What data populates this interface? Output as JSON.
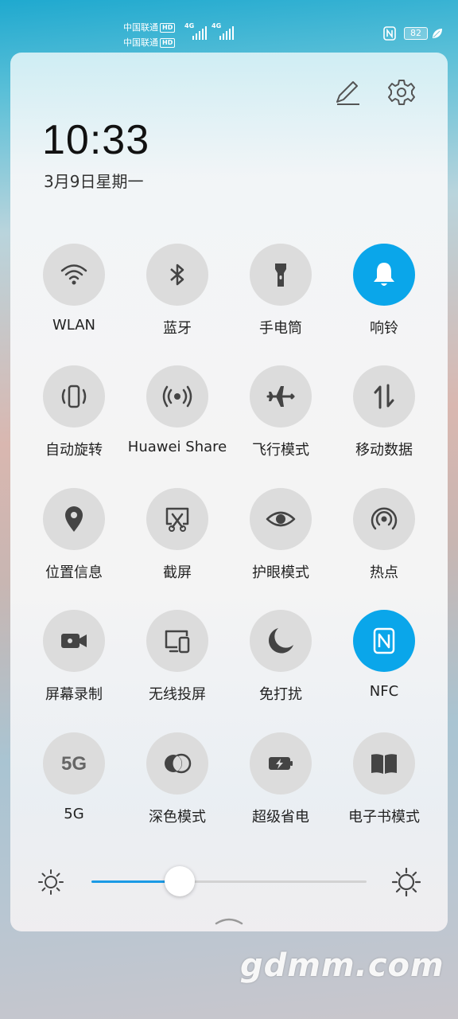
{
  "status_bar": {
    "carriers": [
      {
        "name": "中国联通",
        "badge": "HD"
      },
      {
        "name": "中国联通",
        "badge": "HD"
      }
    ],
    "network_tags": [
      "4G",
      "4G"
    ],
    "battery_level": "82",
    "icons": [
      "nfc-icon",
      "battery-icon",
      "leaf-icon"
    ]
  },
  "header": {
    "time": "10:33",
    "date": "3月9日星期一",
    "icons": [
      "edit-icon",
      "settings-icon"
    ]
  },
  "tiles": [
    {
      "label": "WLAN",
      "icon": "wifi-icon",
      "active": false
    },
    {
      "label": "蓝牙",
      "icon": "bluetooth-icon",
      "active": false
    },
    {
      "label": "手电筒",
      "icon": "flashlight-icon",
      "active": false
    },
    {
      "label": "响铃",
      "icon": "bell-icon",
      "active": true
    },
    {
      "label": "自动旋转",
      "icon": "auto-rotate-icon",
      "active": false
    },
    {
      "label": "Huawei Share",
      "icon": "huawei-share-icon",
      "active": false
    },
    {
      "label": "飞行模式",
      "icon": "airplane-icon",
      "active": false
    },
    {
      "label": "移动数据",
      "icon": "mobile-data-icon",
      "active": false
    },
    {
      "label": "位置信息",
      "icon": "location-icon",
      "active": false
    },
    {
      "label": "截屏",
      "icon": "screenshot-icon",
      "active": false
    },
    {
      "label": "护眼模式",
      "icon": "eye-icon",
      "active": false
    },
    {
      "label": "热点",
      "icon": "hotspot-icon",
      "active": false
    },
    {
      "label": "屏幕录制",
      "icon": "video-icon",
      "active": false
    },
    {
      "label": "无线投屏",
      "icon": "wireless-projection-icon",
      "active": false
    },
    {
      "label": "免打扰",
      "icon": "moon-icon",
      "active": false
    },
    {
      "label": "NFC",
      "icon": "nfc-icon",
      "active": true
    },
    {
      "label": "5G",
      "icon": "5g-icon",
      "icon_text": "5G",
      "active": false
    },
    {
      "label": "深色模式",
      "icon": "dark-mode-icon",
      "active": false
    },
    {
      "label": "超级省电",
      "icon": "battery-saver-icon",
      "active": false
    },
    {
      "label": "电子书模式",
      "icon": "ebook-icon",
      "active": false
    }
  ],
  "brightness": {
    "level": 0.32,
    "icons": [
      "sun-small-icon",
      "sun-large-icon"
    ]
  },
  "colors": {
    "accent": "#0AA6EA",
    "slider_fill": "#1A9AE5",
    "tile_inactive": "#DCDCDC",
    "icon_inactive": "#444444"
  },
  "watermark": "gdmm.com"
}
